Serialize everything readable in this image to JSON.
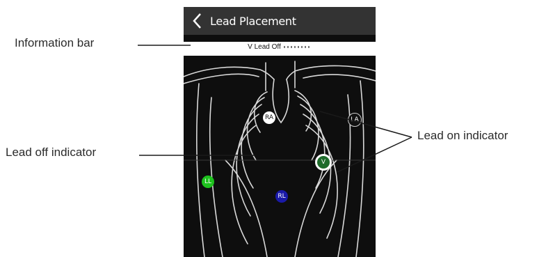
{
  "callouts": {
    "information_bar": "Information bar",
    "lead_off_indicator": "Lead off indicator",
    "lead_on_indicator": "Lead on indicator"
  },
  "screen": {
    "title": "Lead Placement",
    "back_icon": "chevron-left-icon",
    "info_bar_text": "V Lead Off"
  },
  "electrodes": {
    "ra": "RA",
    "la": "LA",
    "v": "V",
    "ll": "LL",
    "rl": "RL"
  },
  "colors": {
    "title_bar": "#333333",
    "ra_fill": "#ffffff",
    "la_fill": "#111111",
    "v_fill": "#1e6b2b",
    "ll_fill": "#1ec21e",
    "rl_fill": "#1a1aa8",
    "line": "#d9d9d9"
  }
}
